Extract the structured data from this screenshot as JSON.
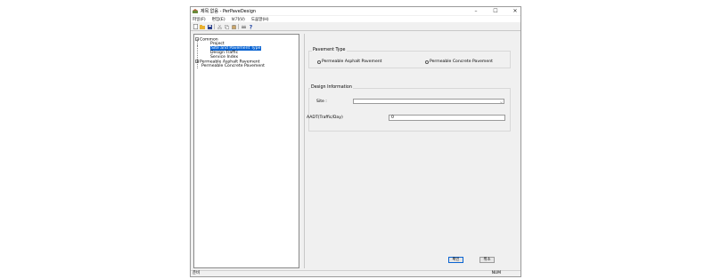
{
  "window": {
    "title": "제목 없음 - PerPaveDesign",
    "controls": {
      "minimize": "–",
      "maximize": "☐",
      "close": "✕"
    }
  },
  "menu": [
    {
      "label": "파일(F)"
    },
    {
      "label": "편집(E)"
    },
    {
      "label": "보기(V)"
    },
    {
      "label": "도움말(H)"
    }
  ],
  "toolbar": {
    "icons": [
      "new-file-icon",
      "open-folder-icon",
      "save-icon",
      "cut-icon",
      "copy-icon",
      "paste-icon",
      "print-icon",
      "help-icon"
    ]
  },
  "tree": {
    "common": "Common",
    "project": "Project",
    "site_and_pavement_type": "Site and Pavement Type",
    "design_traffic": "Design Traffic",
    "service_index": "Service Index",
    "permeable_asphalt": "Permeable Asphalt Pavement",
    "permeable_concrete": "Permeable Concrete Pavement",
    "selected": "Site and Pavement Type"
  },
  "pavement_type": {
    "title": "Pavement Type",
    "option_asphalt": "Permeable Asphalt Pavement",
    "option_concrete": "Permeable Concrete Pavement"
  },
  "design_info": {
    "title": "Design Information",
    "site_label": "Site :",
    "site_value": "",
    "aadt_label": "AADT(Traffic/Day)",
    "aadt_value": "0"
  },
  "buttons": {
    "ok": "확인",
    "cancel": "취소"
  },
  "status": {
    "left": "준비",
    "right": "NUM"
  },
  "colors": {
    "selection": "#0a64d2",
    "background": "#f0f0f0"
  }
}
